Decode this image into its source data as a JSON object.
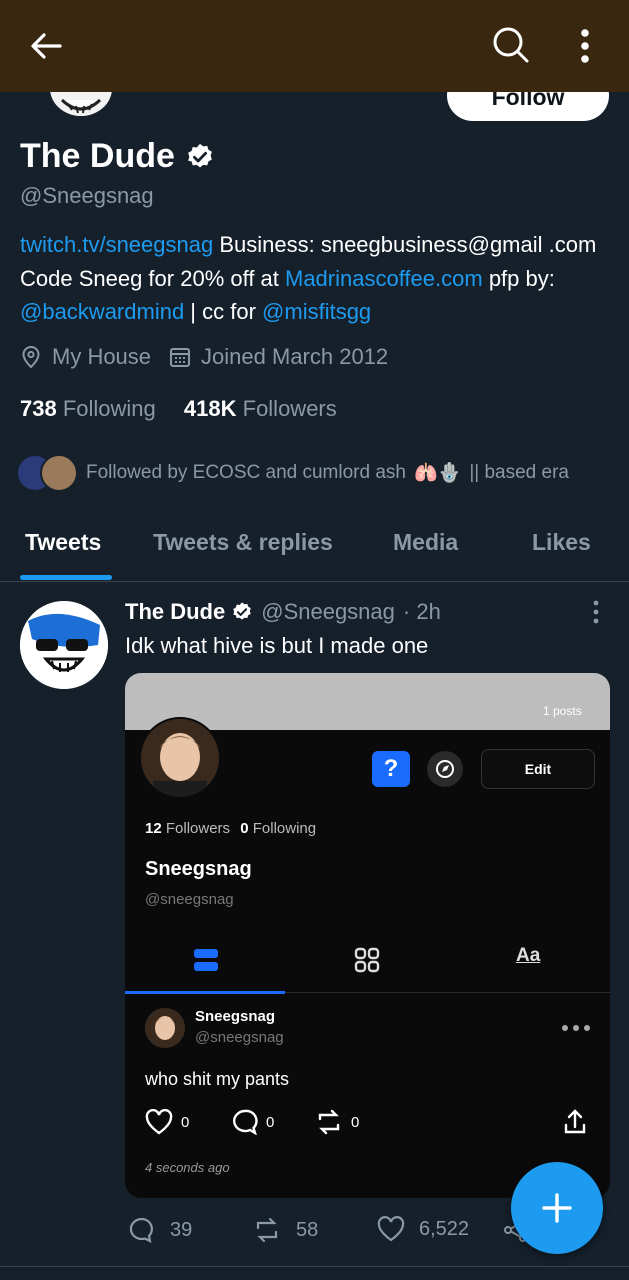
{
  "profile": {
    "follow_label": "Follow",
    "name": "The Dude",
    "handle": "@Sneegsnag",
    "bio": {
      "link1": "twitch.tv/sneegsnag",
      "text1": " Business: sneegbusiness@gmail .com Code Sneeg for 20% off at ",
      "link2": "Madrinascoffee.com",
      "text2": " pfp by: ",
      "mention1": "@backwardmind",
      "text3": " | cc for ",
      "mention2": "@misfitsgg"
    },
    "location": "My House",
    "joined": "Joined March 2012",
    "following_count": "738",
    "following_label": "Following",
    "followers_count": "418K",
    "followers_label": "Followers",
    "followed_by": "Followed by ECOSC and cumlord ash",
    "followed_by_emoji": "🫁🪬",
    "followed_by_suffix": "|| based era"
  },
  "tabs": [
    "Tweets",
    "Tweets & replies",
    "Media",
    "Likes"
  ],
  "tweet": {
    "name": "The Dude",
    "handle": "@Sneegsnag",
    "time": "· 2h",
    "text": "Idk what hive is but I made one",
    "embed": {
      "posts": "1 posts",
      "question": "?",
      "edit": "Edit",
      "followers_count": "12",
      "followers_label": "Followers",
      "following_count": "0",
      "following_label": "Following",
      "name": "Sneegsnag",
      "handle": "@sneegsnag",
      "font_tab": "Aa",
      "post_name": "Sneegsnag",
      "post_handle": "@sneegsnag",
      "post_text": "who shit my pants",
      "like_count": "0",
      "comment_count": "0",
      "repost_count": "0",
      "time": "4 seconds ago"
    },
    "replies": "39",
    "retweets": "58",
    "likes": "6,522"
  },
  "colors": {
    "accent": "#1d9bf0",
    "background": "#15202b",
    "topbar": "#3a2710",
    "muted": "#8b98a5"
  }
}
